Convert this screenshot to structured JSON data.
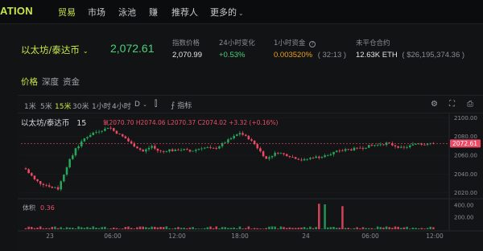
{
  "nav": {
    "brand": "ATION",
    "items": [
      {
        "label": "贸易",
        "active": true
      },
      {
        "label": "市场",
        "active": false
      },
      {
        "label": "泳池",
        "active": false
      },
      {
        "label": "赚",
        "active": false
      },
      {
        "label": "推荐人",
        "active": false
      },
      {
        "label": "更多的",
        "active": false
      }
    ]
  },
  "ticker": {
    "pair": "以太坊/泰达币",
    "price": "2,072.61",
    "index_label": "指数价格",
    "index_value": "2,070.99",
    "change_label": "24小时变化",
    "change_value": "+0.53%",
    "funding_label": "1小时资金",
    "funding_value": "0.003520%",
    "funding_timer": "( 32:13 )",
    "oi_label": "未平仓合约",
    "oi_value": "12.63K ETH",
    "oi_usd": "( $26,195,374.36 )"
  },
  "tabs": [
    "价格",
    "深度",
    "资金"
  ],
  "toolbar": {
    "timeframes": [
      {
        "label": "1米",
        "active": false
      },
      {
        "label": "5米",
        "active": false
      },
      {
        "label": "15米",
        "active": true
      },
      {
        "label": "30米",
        "active": false
      },
      {
        "label": "1小时",
        "active": false
      },
      {
        "label": "4小时",
        "active": false
      },
      {
        "label": "D",
        "active": false
      }
    ],
    "indicators_label": "指标"
  },
  "legend": {
    "pair": "以太坊/泰达币",
    "interval": "15",
    "ohlc_text": "氧2070.70 H2074.06 L2070.37 C2074.02 +3.32 (+0.16%)"
  },
  "volume": {
    "label": "体积",
    "value": "0.36"
  },
  "colors": {
    "up": "#26a65b",
    "down": "#ef4a64",
    "accent": "#c7e84b",
    "last_price_bg": "#ef4a64"
  },
  "chart_data": {
    "type": "candlestick",
    "y_ticks": [
      "2100.00",
      "2080.00",
      "2060.00",
      "2040.00",
      "2020.00"
    ],
    "ylim": [
      2017,
      2103
    ],
    "x_ticks": [
      "23",
      "06:00",
      "12:00",
      "18:00",
      "24",
      "06:00",
      "12:00"
    ],
    "last_price": "2072.61",
    "volume_ticks": [
      "400.00",
      "200.00"
    ],
    "close_path": [
      2045,
      2041,
      2038,
      2034,
      2032,
      2030,
      2029,
      2028,
      2027,
      2025,
      2026,
      2024,
      2032,
      2040,
      2048,
      2055,
      2060,
      2068,
      2070,
      2074,
      2078,
      2080,
      2082,
      2084,
      2085,
      2086,
      2087,
      2088,
      2090,
      2089,
      2086,
      2084,
      2082,
      2080,
      2078,
      2075,
      2072,
      2070,
      2068,
      2066,
      2064,
      2066,
      2068,
      2070,
      2067,
      2065,
      2064,
      2064,
      2065,
      2066,
      2065,
      2065,
      2066,
      2066,
      2066,
      2065,
      2064,
      2065,
      2066,
      2067,
      2068,
      2068,
      2068,
      2067,
      2067,
      2068,
      2070,
      2072,
      2074,
      2076,
      2078,
      2080,
      2082,
      2084,
      2082,
      2080,
      2078,
      2075,
      2072,
      2068,
      2064,
      2060,
      2056,
      2058,
      2060,
      2062,
      2063,
      2062,
      2061,
      2060,
      2059,
      2058,
      2057,
      2056,
      2055,
      2055,
      2056,
      2057,
      2058,
      2058,
      2058,
      2059,
      2060,
      2061,
      2062,
      2063,
      2064,
      2064,
      2065,
      2066,
      2066,
      2066,
      2067,
      2067,
      2068,
      2068,
      2069,
      2070,
      2070,
      2071,
      2071,
      2072,
      2072,
      2073,
      2072,
      2071,
      2070,
      2069,
      2068,
      2068,
      2069,
      2070,
      2071,
      2072,
      2073,
      2072,
      2072,
      2073,
      2073,
      2072
    ],
    "volume_spikes": [
      {
        "index": 100,
        "value": 420
      },
      {
        "index": 102,
        "value": 410
      },
      {
        "index": 108,
        "value": 380
      }
    ]
  }
}
